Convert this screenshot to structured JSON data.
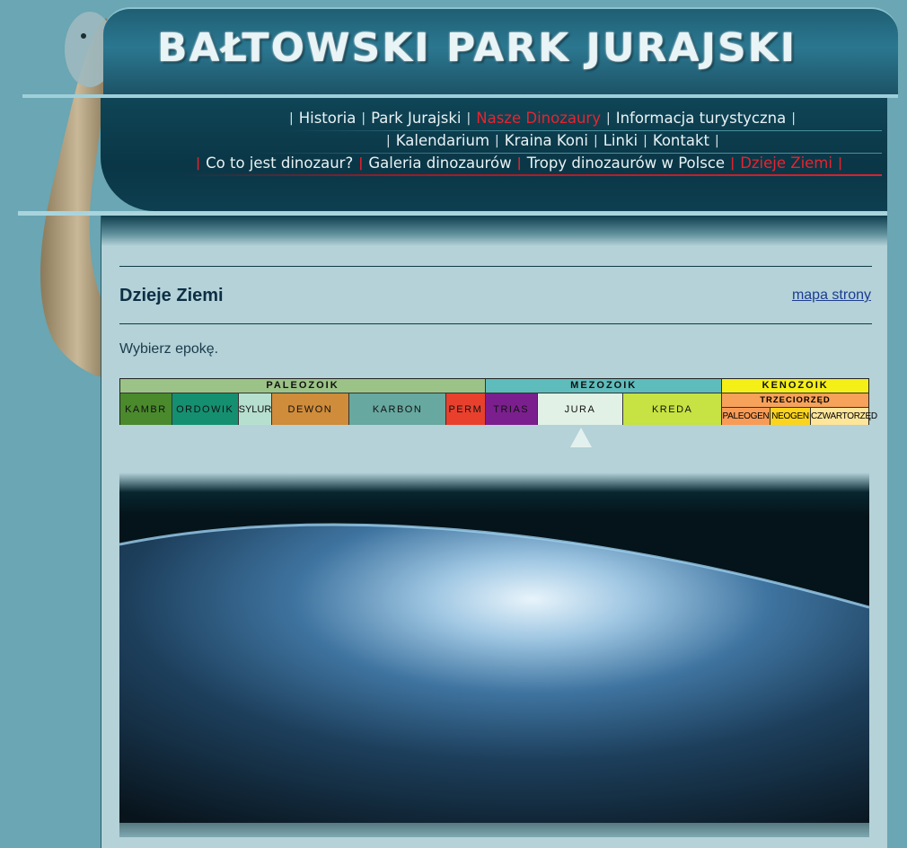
{
  "banner": {
    "title": "BAŁTOWSKI PARK JURAJSKI"
  },
  "nav": {
    "row1": [
      "Historia",
      "Park Jurajski",
      "Nasze Dinozaury",
      "Informacja turystyczna"
    ],
    "row2": [
      "Kalendarium",
      "Kraina Koni",
      "Linki",
      "Kontakt"
    ],
    "row3": [
      "Co to jest dinozaur?",
      "Galeria dinozaurów",
      "Tropy dinozaurów w Polsce",
      "Dzieje Ziemi"
    ]
  },
  "page": {
    "title": "Dzieje Ziemi",
    "sitemap_link": "mapa strony",
    "lead": "Wybierz epokę."
  },
  "timeline": {
    "eras": [
      {
        "label": "PALEOZOIK",
        "color": "#9cc387"
      },
      {
        "label": "MEZOZOIK",
        "color": "#5fbcbc"
      },
      {
        "label": "KENOZOIK",
        "color": "#f5ef18"
      }
    ],
    "periods": [
      {
        "label": "KAMBR",
        "color": "#4a8a2c"
      },
      {
        "label": "ORDOWIK",
        "color": "#149071"
      },
      {
        "label": "SYLUR",
        "color": "#b6dfd0"
      },
      {
        "label": "DEWON",
        "color": "#cf8c3b"
      },
      {
        "label": "KARBON",
        "color": "#67a8a0"
      },
      {
        "label": "PERM",
        "color": "#e8402d"
      },
      {
        "label": "TRIAS",
        "color": "#7b1f8e"
      },
      {
        "label": "JURA",
        "color": "#e1f1e5"
      },
      {
        "label": "KREDA",
        "color": "#c6e243"
      }
    ],
    "tertiary": {
      "label": "TRZECIORZĘD",
      "color": "#f6a25b"
    },
    "cenozoic_periods": [
      {
        "label": "PALEOGEN",
        "color": "#f89b57"
      },
      {
        "label": "NEOGEN",
        "color": "#fbd41e"
      },
      {
        "label": "CZWARTORZĘD",
        "color": "#fde59a"
      }
    ],
    "selected": "JURA"
  },
  "colors": {
    "background": "#6aa6b3",
    "panel": "#b4d2d8",
    "nav_active": "#e8232f"
  }
}
